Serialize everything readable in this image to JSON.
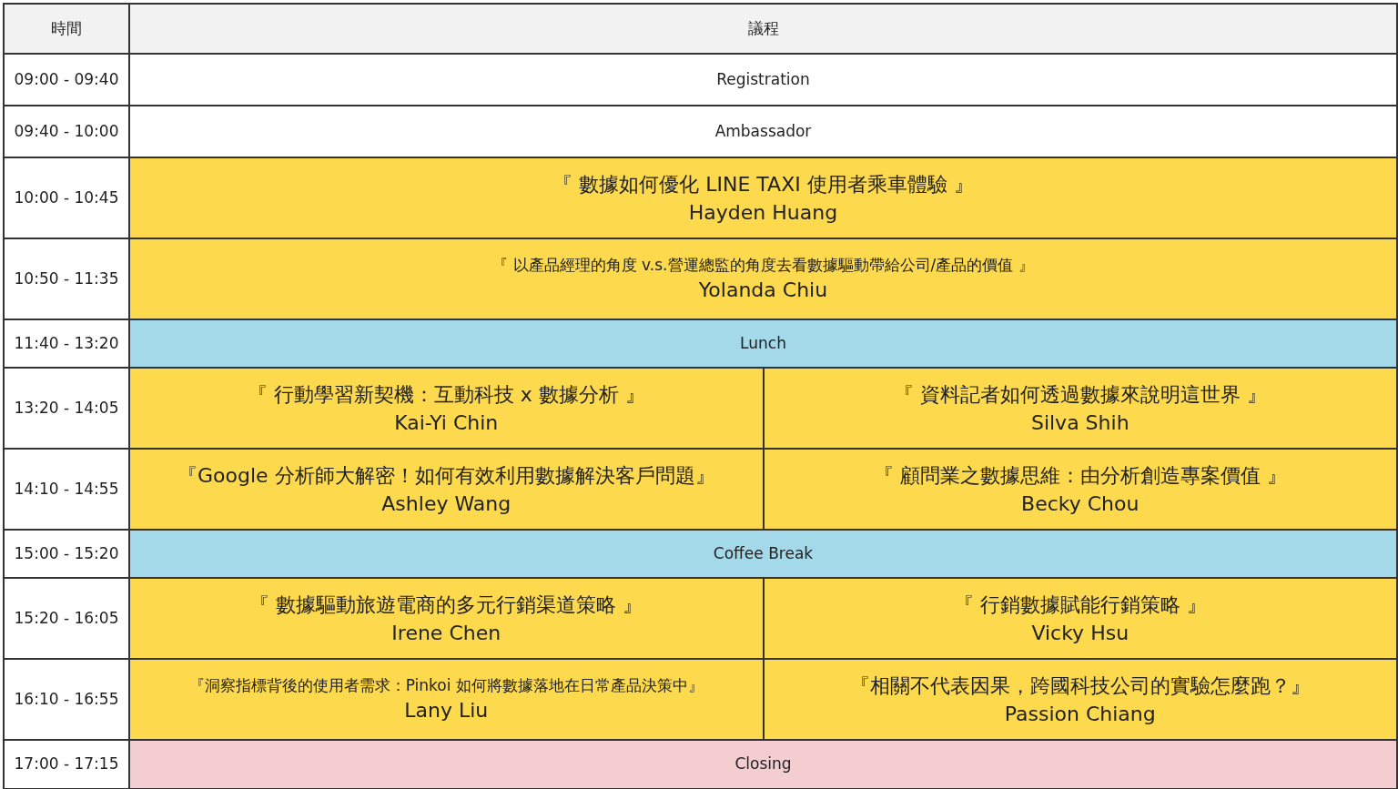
{
  "columns": [
    "時間",
    "議程"
  ],
  "rows": [
    {
      "time": "09:00 - 09:40",
      "kind": "plain",
      "sessions": [
        {
          "title": "Registration"
        }
      ]
    },
    {
      "time": "09:40 - 10:00",
      "kind": "plain",
      "sessions": [
        {
          "title": "Ambassador"
        }
      ]
    },
    {
      "time": "10:00 - 10:45",
      "kind": "talk",
      "sessions": [
        {
          "title": "『 數據如何優化 LINE TAXI 使用者乘車體驗 』",
          "speaker": "Hayden Huang"
        }
      ]
    },
    {
      "time": "10:50 - 11:35",
      "kind": "talk",
      "sessions": [
        {
          "title": "『 以產品經理的角度 v.s.營運總監的角度去看數據驅動帶給公司/產品的價值 』",
          "speaker": "Yolanda Chiu"
        }
      ]
    },
    {
      "time": "11:40 - 13:20",
      "kind": "break",
      "sessions": [
        {
          "title": "Lunch"
        }
      ]
    },
    {
      "time": "13:20 - 14:05",
      "kind": "talk",
      "sessions": [
        {
          "title": "『 行動學習新契機：互動科技 x 數據分析 』",
          "speaker": "Kai-Yi Chin"
        },
        {
          "title": "『 資料記者如何透過數據來說明這世界 』",
          "speaker": "Silva Shih"
        }
      ]
    },
    {
      "time": "14:10 - 14:55",
      "kind": "talk",
      "sessions": [
        {
          "title": "『Google 分析師大解密！如何有效利用數據解決客戶問題』",
          "speaker": "Ashley Wang"
        },
        {
          "title": "『 顧問業之數據思維：由分析創造專案價值 』",
          "speaker": "Becky Chou"
        }
      ]
    },
    {
      "time": "15:00 - 15:20",
      "kind": "break",
      "sessions": [
        {
          "title": "Coffee Break"
        }
      ]
    },
    {
      "time": "15:20 - 16:05",
      "kind": "talk",
      "sessions": [
        {
          "title": "『 數據驅動旅遊電商的多元行銷渠道策略 』",
          "speaker": "Irene Chen"
        },
        {
          "title": "『 行銷數據賦能行銷策略 』",
          "speaker": "Vicky Hsu"
        }
      ]
    },
    {
      "time": "16:10 - 16:55",
      "kind": "talk",
      "sessions": [
        {
          "title": "『洞察指標背後的使用者需求：Pinkoi 如何將數據落地在日常產品決策中』",
          "speaker": "Lany Liu"
        },
        {
          "title": "『相關不代表因果，跨國科技公司的實驗怎麼跑？』",
          "speaker": "Passion Chiang"
        }
      ]
    },
    {
      "time": "17:00 - 17:15",
      "kind": "closing",
      "sessions": [
        {
          "title": "Closing"
        }
      ]
    }
  ]
}
